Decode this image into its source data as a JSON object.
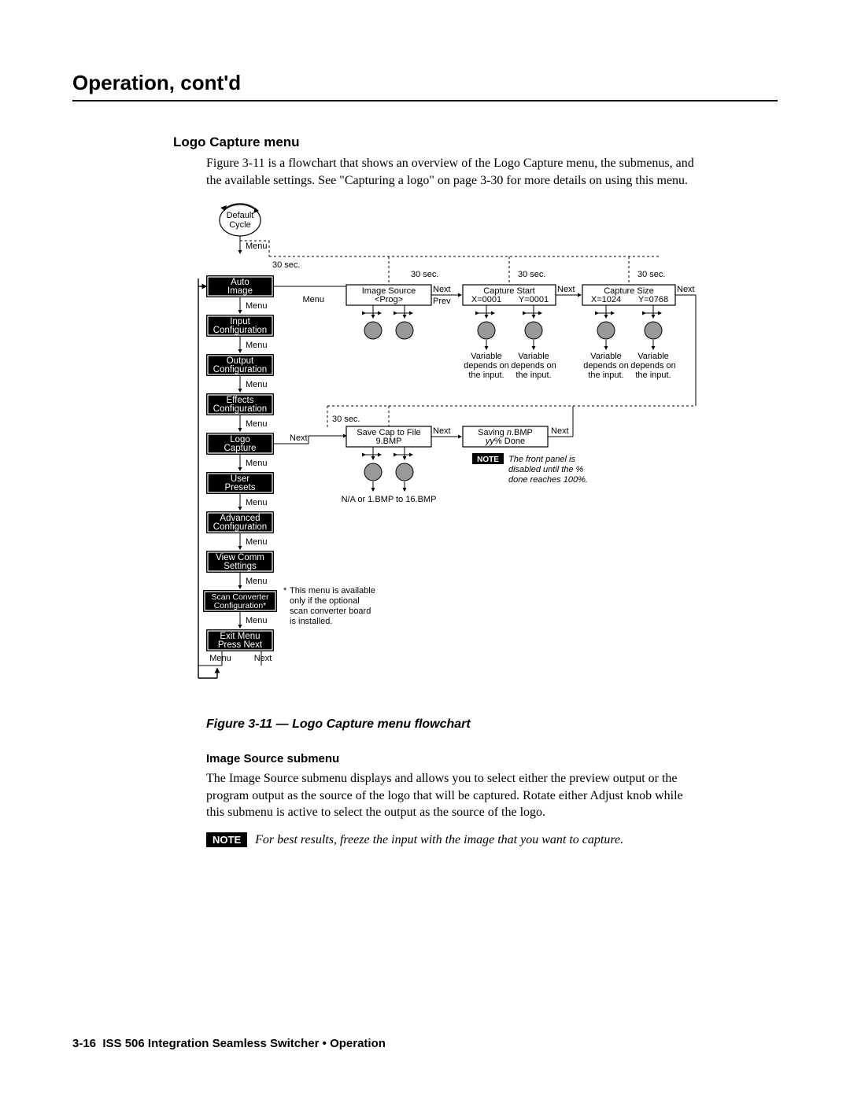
{
  "header": {
    "title": "Operation, cont'd"
  },
  "section": {
    "h1": "Logo Capture menu",
    "intro": "Figure 3-11 is a flowchart that shows an overview of the Logo Capture menu, the submenus, and the available settings.  See \"Capturing a logo\" on page 3-30 for more details on using this menu."
  },
  "figure": {
    "caption": "Figure 3-11 — Logo Capture menu flowchart",
    "default_cycle": [
      "Default",
      "Cycle"
    ],
    "menu_label": "Menu",
    "next_label": "Next",
    "prev_label": "Prev",
    "thirty_sec": "30 sec.",
    "menus": [
      {
        "l1": "Auto",
        "l2": "Image"
      },
      {
        "l1": "Input",
        "l2": "Configuration"
      },
      {
        "l1": "Output",
        "l2": "Configuration"
      },
      {
        "l1": "Effects",
        "l2": "Configuration"
      },
      {
        "l1": "Logo",
        "l2": "Capture"
      },
      {
        "l1": "User",
        "l2": "Presets"
      },
      {
        "l1": "Advanced",
        "l2": "Configuration"
      },
      {
        "l1": "View Comm",
        "l2": "Settings"
      },
      {
        "l1": "Scan Converter",
        "l2": "Configuration*"
      },
      {
        "l1": "Exit Menu",
        "l2": "Press Next"
      }
    ],
    "row1": {
      "b1": {
        "l1": "Image Source",
        "l2": "<Prog>",
        "menu": "Menu"
      },
      "b2": {
        "l1": "Capture Start",
        "l2a": "X=0001",
        "l2b": "Y=0001"
      },
      "b3": {
        "l1": "Capture Size",
        "l2a": "X=1024",
        "l2b": "Y=0768"
      }
    },
    "row2": {
      "b1": {
        "l1": "Save Cap to File",
        "l2": "9.BMP"
      },
      "b2": {
        "l1a": "Saving ",
        "l1b": "n",
        "l1c": ".BMP",
        "l2a": "yy",
        "l2b": "% Done"
      }
    },
    "var_note": [
      "Variable",
      "depends on",
      "the input."
    ],
    "bmp_note": "N/A or 1.BMP to 16.BMP",
    "panel_note": {
      "badge": "NOTE",
      "l1": "The front panel is",
      "l2": "disabled until the %",
      "l3": "done reaches 100%."
    },
    "star_note": {
      "l0": "*",
      "l1": "This menu is available",
      "l2": "only if the optional",
      "l3": "scan converter board",
      "l4": "is installed."
    }
  },
  "sub": {
    "h": "Image Source submenu",
    "p": "The Image Source submenu displays and allows you to select either the preview output or the program output as the source of the logo that will be captured.  Rotate either Adjust knob while this submenu is active to select the output as the source of the logo.",
    "note_badge": "NOTE",
    "note_text": "For best results, freeze the input with the image that you want to capture."
  },
  "footer": {
    "page_num": "3-16",
    "title": "ISS 506 Integration Seamless Switcher • Operation"
  }
}
